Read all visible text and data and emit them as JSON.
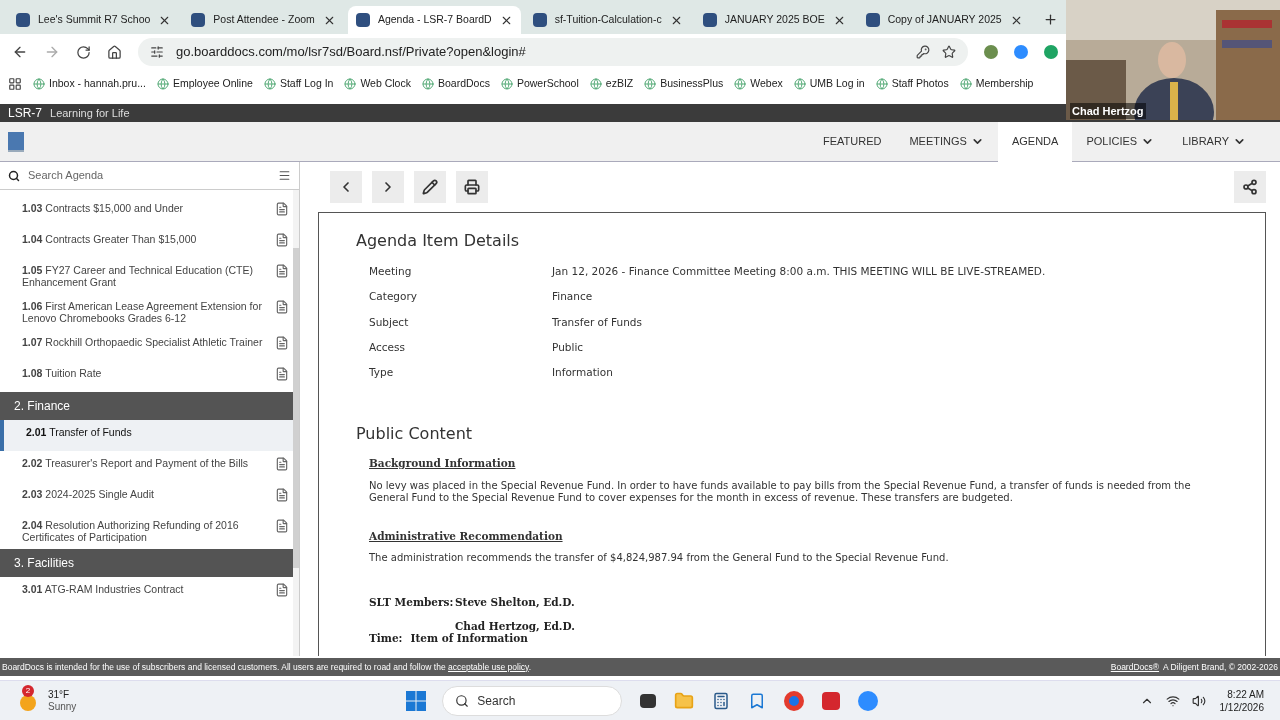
{
  "browser": {
    "tabs": [
      {
        "title": "Lee's Summit R7 Schoo",
        "selected": false
      },
      {
        "title": "Post Attendee - Zoom",
        "selected": false
      },
      {
        "title": "Agenda - LSR-7 BoardD",
        "selected": true
      },
      {
        "title": "sf-Tuition-Calculation-c",
        "selected": false
      },
      {
        "title": "JANUARY 2025 BOE",
        "selected": false
      },
      {
        "title": "Copy of JANUARY 2025",
        "selected": false
      }
    ],
    "url": "go.boarddocs.com/mo/lsr7sd/Board.nsf/Private?open&login#",
    "bookmarks": [
      "Inbox - hannah.pru...",
      "Employee Online",
      "Staff Log In",
      "Web Clock",
      "BoardDocs",
      "PowerSchool",
      "ezBIZ",
      "BusinessPlus",
      "Webex",
      "UMB Log in",
      "Staff Photos",
      "Membership"
    ]
  },
  "site": {
    "name": "LSR-7",
    "tagline": "Learning for Life",
    "nav": [
      {
        "label": "FEATURED",
        "has_menu": false,
        "selected": false
      },
      {
        "label": "MEETINGS",
        "has_menu": true,
        "selected": false
      },
      {
        "label": "AGENDA",
        "has_menu": false,
        "selected": true
      },
      {
        "label": "POLICIES",
        "has_menu": true,
        "selected": false
      },
      {
        "label": "LIBRARY",
        "has_menu": true,
        "selected": false
      }
    ]
  },
  "sidebar": {
    "search": {
      "placeholder": "Search Agenda"
    },
    "items": [
      {
        "kind": "item",
        "text": "**1.03** Contracts $15,000 and Under",
        "selected": false
      },
      {
        "kind": "item",
        "text": "**1.04** Contracts Greater Than $15,000",
        "selected": false
      },
      {
        "kind": "item",
        "text": "**1.05** FY27 Career and Technical Education (CTE) Enhancement Grant",
        "selected": false
      },
      {
        "kind": "item",
        "text": "**1.06** First American Lease Agreement Extension for Lenovo Chromebooks Grades 6-12",
        "selected": false
      },
      {
        "kind": "item",
        "text": "**1.07** Rockhill Orthopaedic Specialist Athletic Trainer",
        "selected": false
      },
      {
        "kind": "item",
        "text": "**1.08** Tuition Rate",
        "selected": false
      },
      {
        "kind": "section",
        "text": "2. Finance"
      },
      {
        "kind": "item",
        "text": "**2.01** Transfer of Funds",
        "selected": true
      },
      {
        "kind": "item",
        "text": "**2.02** Treasurer's Report and Payment of the Bills",
        "selected": false
      },
      {
        "kind": "item",
        "text": "**2.03** 2024-2025 Single Audit",
        "selected": false
      },
      {
        "kind": "item",
        "text": "**2.04** Resolution Authorizing Refunding of 2016 Certificates of Participation",
        "selected": false
      },
      {
        "kind": "section",
        "text": "3. Facilities"
      },
      {
        "kind": "item",
        "text": "**3.01** ATG-RAM Industries Contract",
        "selected": false
      }
    ]
  },
  "details": {
    "title": "Agenda Item Details",
    "rows": [
      {
        "label": "Meeting",
        "value": "Jan 12, 2026 - Finance Committee Meeting 8:00 a.m. THIS MEETING WILL BE LIVE-STREAMED."
      },
      {
        "label": "Category",
        "value": "Finance"
      },
      {
        "label": "Subject",
        "value": "Transfer of Funds"
      },
      {
        "label": "Access",
        "value": "Public"
      },
      {
        "label": "Type",
        "value": "Information"
      }
    ]
  },
  "public_content": {
    "title": "Public Content",
    "sections": [
      {
        "heading": "Background Information",
        "body": "No levy was placed in the Special Revenue Fund. In order to have funds available to pay bills from the Special Revenue Fund, a transfer of funds is needed from the General Fund to the Special Revenue Fund to cover expenses for the month in excess of revenue. These transfers are budgeted."
      },
      {
        "heading": "Administrative Recommendation",
        "body": "The administration recommends the transfer of $4,824,987.94 from the General Fund to the Special Revenue Fund."
      }
    ],
    "slt_label": "SLT Members:",
    "slt_members": [
      "Steve Shelton, Ed.D.",
      "Chad Hertzog, Ed.D."
    ],
    "time_label": "Time:",
    "time_value": "Item of Information"
  },
  "footer": {
    "notice": "BoardDocs is intended for the use of subscribers and licensed customers. All users are required to road and follow the",
    "link": "acceptable use policy",
    "end": ".",
    "brand_link": "BoardDocs®",
    "brand": "A Diligent Brand, © 2002-2026"
  },
  "video": {
    "name": "Chad Hertzog"
  },
  "taskbar": {
    "temperature": "31°F",
    "condition": "Sunny",
    "badge": "2",
    "search": "Search",
    "time": "8:22 AM",
    "date": "1/12/2026"
  }
}
